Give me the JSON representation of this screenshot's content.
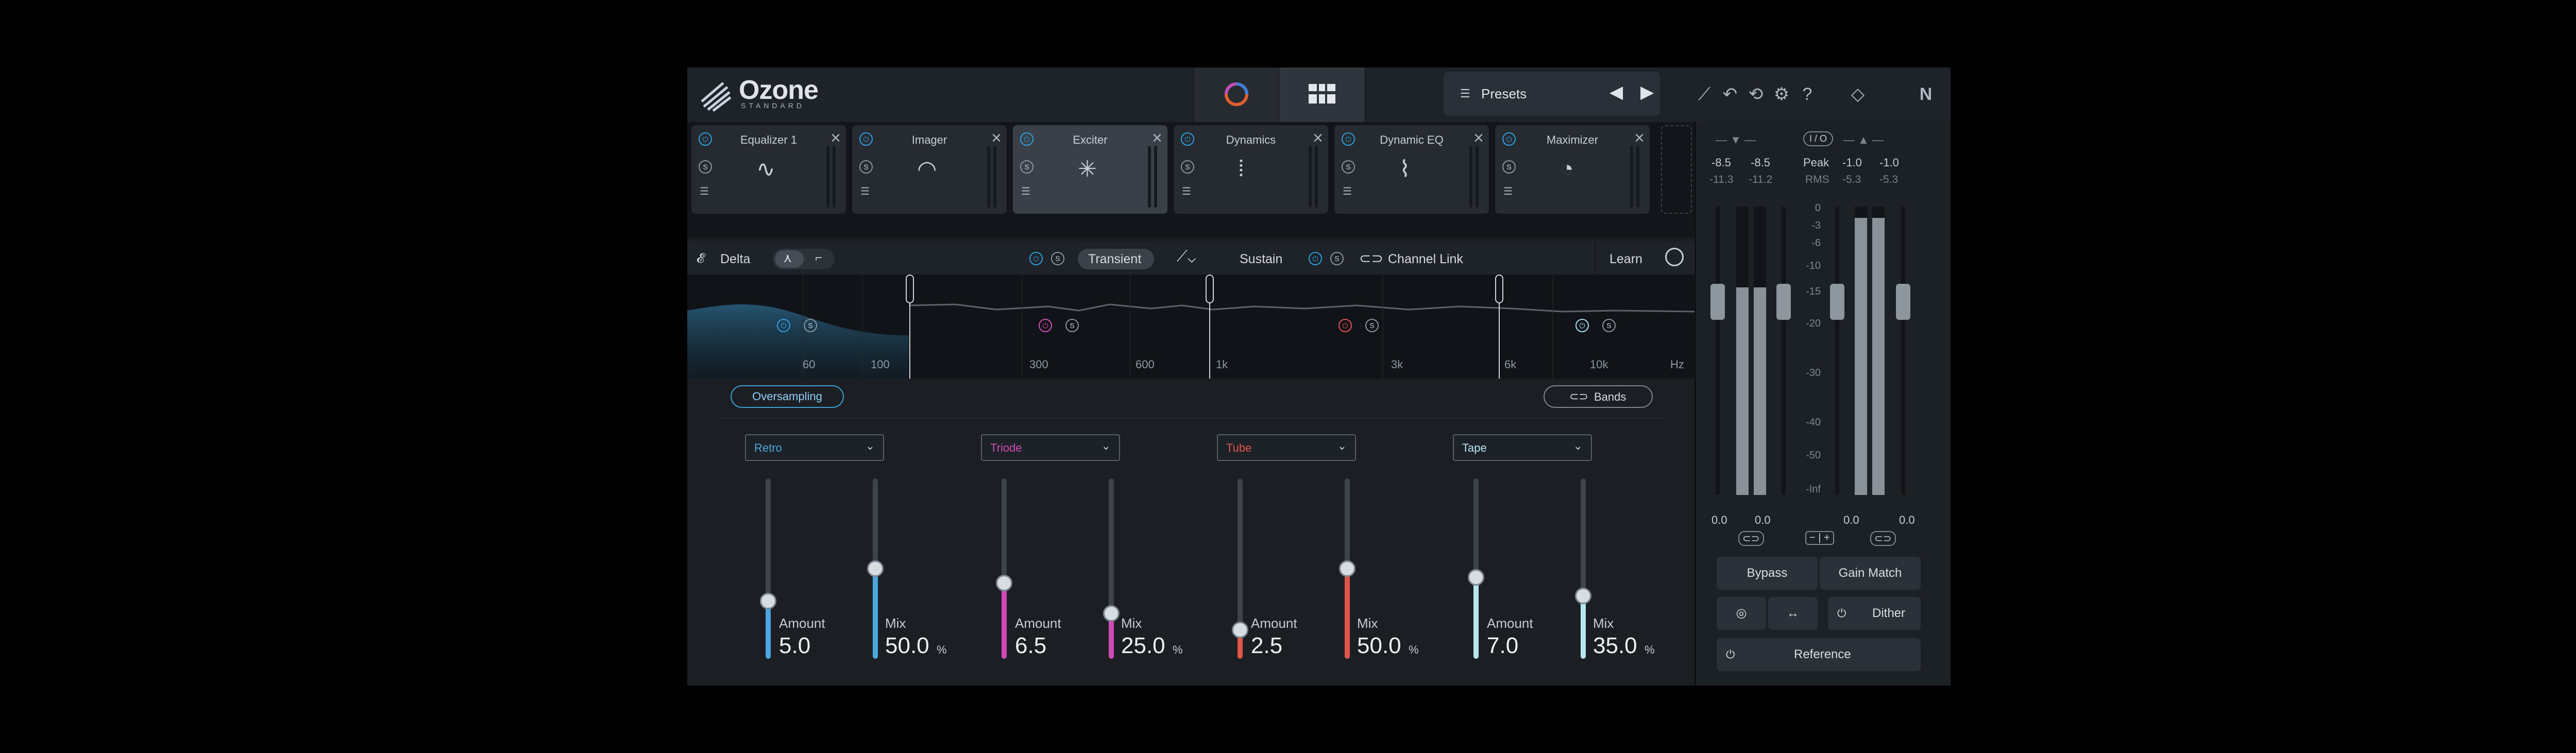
{
  "header": {
    "logo_word": "Ozone",
    "logo_sub": "STANDARD",
    "presets_label": "Presets",
    "icons": [
      "spectrum-view-icon",
      "grid-view-icon",
      "list-icon",
      "prev-arrow-icon",
      "next-arrow-icon",
      "wand-icon",
      "undo-icon",
      "history-icon",
      "settings-icon",
      "help-icon",
      "plugin-icon",
      "ni-logo-icon"
    ]
  },
  "modules": [
    {
      "name": "Equalizer 1",
      "selected": false
    },
    {
      "name": "Imager",
      "selected": false
    },
    {
      "name": "Exciter",
      "selected": true
    },
    {
      "name": "Dynamics",
      "selected": false
    },
    {
      "name": "Dynamic EQ",
      "selected": false
    },
    {
      "name": "Maximizer",
      "selected": false
    }
  ],
  "control_bar": {
    "delta": "Delta",
    "transient": "Transient",
    "sustain": "Sustain",
    "channel_link": "Channel Link",
    "learn": "Learn"
  },
  "spectrum": {
    "freq_labels": [
      "60",
      "100",
      "300",
      "600",
      "1k",
      "3k",
      "6k",
      "10k",
      "Hz"
    ],
    "band_colors": [
      "#2f9de0",
      "#d64bb5",
      "#e0534f",
      "#9fe0ee"
    ]
  },
  "lower": {
    "oversampling": "Oversampling",
    "bands": "Bands",
    "bands_list": [
      {
        "mode": "Retro",
        "color": "#4aa7df",
        "amount_label": "Amount",
        "amount": "5.0",
        "amount_level": 0.32,
        "mix_label": "Mix",
        "mix": "50.0",
        "mix_level": 0.5,
        "pct": "%"
      },
      {
        "mode": "Triode",
        "color": "#d049b4",
        "amount_label": "Amount",
        "amount": "6.5",
        "amount_level": 0.42,
        "mix_label": "Mix",
        "mix": "25.0",
        "mix_level": 0.25,
        "pct": "%"
      },
      {
        "mode": "Tube",
        "color": "#e05548",
        "amount_label": "Amount",
        "amount": "2.5",
        "amount_level": 0.16,
        "mix_label": "Mix",
        "mix": "50.0",
        "mix_level": 0.5,
        "pct": "%"
      },
      {
        "mode": "Tape",
        "color": "#b8e6ee",
        "amount_label": "Amount",
        "amount": "7.0",
        "amount_level": 0.45,
        "mix_label": "Mix",
        "mix": "35.0",
        "mix_level": 0.35,
        "pct": "%"
      }
    ]
  },
  "meters": {
    "io_label": "I / O",
    "in_peak": [
      "-8.5",
      "-8.5"
    ],
    "in_rms": [
      "-11.3",
      "-11.2"
    ],
    "peak_label": "Peak",
    "rms_label": "RMS",
    "out_peak": [
      "-1.0",
      "-1.0"
    ],
    "out_rms": [
      "-5.3",
      "-5.3"
    ],
    "scale": [
      "0",
      "-3",
      "-6",
      "-10",
      "-15",
      "-20",
      "-30",
      "-40",
      "-50",
      "-Inf"
    ],
    "in_gain": "0.0",
    "in_gain2": "0.0",
    "out_gain": "0.0",
    "out_gain2": "0.0",
    "in_levels": [
      0.72,
      0.72
    ],
    "out_levels": [
      0.96,
      0.96
    ],
    "bypass": "Bypass",
    "gain_match": "Gain Match",
    "dither": "Dither",
    "reference": "Reference"
  }
}
